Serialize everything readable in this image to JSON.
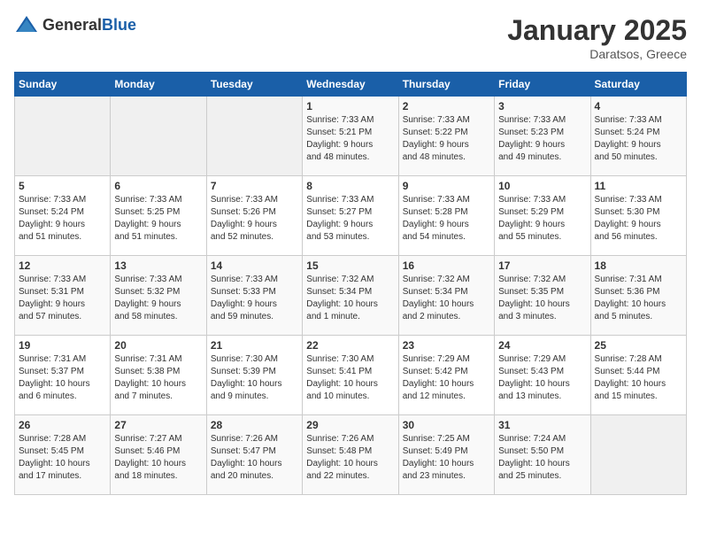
{
  "logo": {
    "text_general": "General",
    "text_blue": "Blue"
  },
  "title": {
    "month_year": "January 2025",
    "location": "Daratsos, Greece"
  },
  "weekdays": [
    "Sunday",
    "Monday",
    "Tuesday",
    "Wednesday",
    "Thursday",
    "Friday",
    "Saturday"
  ],
  "weeks": [
    [
      {
        "day": "",
        "content": ""
      },
      {
        "day": "",
        "content": ""
      },
      {
        "day": "",
        "content": ""
      },
      {
        "day": "1",
        "content": "Sunrise: 7:33 AM\nSunset: 5:21 PM\nDaylight: 9 hours\nand 48 minutes."
      },
      {
        "day": "2",
        "content": "Sunrise: 7:33 AM\nSunset: 5:22 PM\nDaylight: 9 hours\nand 48 minutes."
      },
      {
        "day": "3",
        "content": "Sunrise: 7:33 AM\nSunset: 5:23 PM\nDaylight: 9 hours\nand 49 minutes."
      },
      {
        "day": "4",
        "content": "Sunrise: 7:33 AM\nSunset: 5:24 PM\nDaylight: 9 hours\nand 50 minutes."
      }
    ],
    [
      {
        "day": "5",
        "content": "Sunrise: 7:33 AM\nSunset: 5:24 PM\nDaylight: 9 hours\nand 51 minutes."
      },
      {
        "day": "6",
        "content": "Sunrise: 7:33 AM\nSunset: 5:25 PM\nDaylight: 9 hours\nand 51 minutes."
      },
      {
        "day": "7",
        "content": "Sunrise: 7:33 AM\nSunset: 5:26 PM\nDaylight: 9 hours\nand 52 minutes."
      },
      {
        "day": "8",
        "content": "Sunrise: 7:33 AM\nSunset: 5:27 PM\nDaylight: 9 hours\nand 53 minutes."
      },
      {
        "day": "9",
        "content": "Sunrise: 7:33 AM\nSunset: 5:28 PM\nDaylight: 9 hours\nand 54 minutes."
      },
      {
        "day": "10",
        "content": "Sunrise: 7:33 AM\nSunset: 5:29 PM\nDaylight: 9 hours\nand 55 minutes."
      },
      {
        "day": "11",
        "content": "Sunrise: 7:33 AM\nSunset: 5:30 PM\nDaylight: 9 hours\nand 56 minutes."
      }
    ],
    [
      {
        "day": "12",
        "content": "Sunrise: 7:33 AM\nSunset: 5:31 PM\nDaylight: 9 hours\nand 57 minutes."
      },
      {
        "day": "13",
        "content": "Sunrise: 7:33 AM\nSunset: 5:32 PM\nDaylight: 9 hours\nand 58 minutes."
      },
      {
        "day": "14",
        "content": "Sunrise: 7:33 AM\nSunset: 5:33 PM\nDaylight: 9 hours\nand 59 minutes."
      },
      {
        "day": "15",
        "content": "Sunrise: 7:32 AM\nSunset: 5:34 PM\nDaylight: 10 hours\nand 1 minute."
      },
      {
        "day": "16",
        "content": "Sunrise: 7:32 AM\nSunset: 5:34 PM\nDaylight: 10 hours\nand 2 minutes."
      },
      {
        "day": "17",
        "content": "Sunrise: 7:32 AM\nSunset: 5:35 PM\nDaylight: 10 hours\nand 3 minutes."
      },
      {
        "day": "18",
        "content": "Sunrise: 7:31 AM\nSunset: 5:36 PM\nDaylight: 10 hours\nand 5 minutes."
      }
    ],
    [
      {
        "day": "19",
        "content": "Sunrise: 7:31 AM\nSunset: 5:37 PM\nDaylight: 10 hours\nand 6 minutes."
      },
      {
        "day": "20",
        "content": "Sunrise: 7:31 AM\nSunset: 5:38 PM\nDaylight: 10 hours\nand 7 minutes."
      },
      {
        "day": "21",
        "content": "Sunrise: 7:30 AM\nSunset: 5:39 PM\nDaylight: 10 hours\nand 9 minutes."
      },
      {
        "day": "22",
        "content": "Sunrise: 7:30 AM\nSunset: 5:41 PM\nDaylight: 10 hours\nand 10 minutes."
      },
      {
        "day": "23",
        "content": "Sunrise: 7:29 AM\nSunset: 5:42 PM\nDaylight: 10 hours\nand 12 minutes."
      },
      {
        "day": "24",
        "content": "Sunrise: 7:29 AM\nSunset: 5:43 PM\nDaylight: 10 hours\nand 13 minutes."
      },
      {
        "day": "25",
        "content": "Sunrise: 7:28 AM\nSunset: 5:44 PM\nDaylight: 10 hours\nand 15 minutes."
      }
    ],
    [
      {
        "day": "26",
        "content": "Sunrise: 7:28 AM\nSunset: 5:45 PM\nDaylight: 10 hours\nand 17 minutes."
      },
      {
        "day": "27",
        "content": "Sunrise: 7:27 AM\nSunset: 5:46 PM\nDaylight: 10 hours\nand 18 minutes."
      },
      {
        "day": "28",
        "content": "Sunrise: 7:26 AM\nSunset: 5:47 PM\nDaylight: 10 hours\nand 20 minutes."
      },
      {
        "day": "29",
        "content": "Sunrise: 7:26 AM\nSunset: 5:48 PM\nDaylight: 10 hours\nand 22 minutes."
      },
      {
        "day": "30",
        "content": "Sunrise: 7:25 AM\nSunset: 5:49 PM\nDaylight: 10 hours\nand 23 minutes."
      },
      {
        "day": "31",
        "content": "Sunrise: 7:24 AM\nSunset: 5:50 PM\nDaylight: 10 hours\nand 25 minutes."
      },
      {
        "day": "",
        "content": ""
      }
    ]
  ]
}
